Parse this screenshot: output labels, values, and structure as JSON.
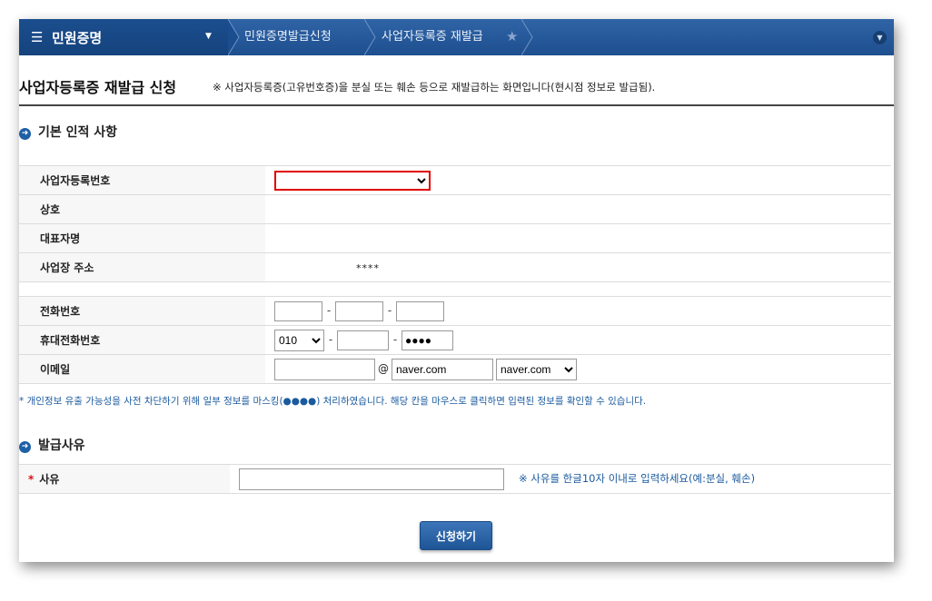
{
  "header": {
    "menu_icon": "☰",
    "menu_title": "민원증명",
    "menu_caret": "▼",
    "breadcrumb": [
      "민원증명발급신청",
      "사업자등록증 재발급"
    ],
    "star_icon": "★",
    "expand_icon": "▼"
  },
  "page": {
    "title": "사업자등록증 재발급 신청",
    "description": "※ 사업자등록증(고유번호증)을 분실 또는 훼손 등으로 재발급하는 화면입니다(현시점 정보로 발급됨)."
  },
  "basic_section": {
    "heading": "기본 인적 사항",
    "bullet": "➜",
    "fields": {
      "bizno_label": "사업자등록번호",
      "bizno_value": "",
      "company_label": "상호",
      "company_value": "",
      "ceo_label": "대표자명",
      "ceo_value": "",
      "address_label": "사업장 주소",
      "address_value": "****"
    }
  },
  "contact": {
    "phone_label": "전화번호",
    "phone": [
      "",
      "",
      ""
    ],
    "mobile_label": "휴대전화번호",
    "mobile_prefix": "010",
    "mobile_mid": "",
    "mobile_last": "●●●●",
    "dash": "-",
    "email_label": "이메일",
    "email_id": "",
    "at": "@",
    "email_domain": "naver.com",
    "email_domain_select": "naver.com"
  },
  "notice": "* 개인정보 유출 가능성을 사전 차단하기 위해 일부 정보를 마스킹(●●●●) 처리하였습니다. 해당 칸을 마우스로 클릭하면 입력된 정보를 확인할 수 있습니다.",
  "reason_section": {
    "heading": "발급사유",
    "bullet": "➜",
    "required_mark": "*",
    "label": "사유",
    "value": "",
    "hint": "※ 사유를 한글10자 이내로 입력하세요(예:분실, 훼손)"
  },
  "submit_label": "신청하기",
  "colors": {
    "header_blue": "#2f64a6",
    "menu_blue": "#1b4e8e",
    "highlight_red": "#e00000",
    "notice_blue": "#1a5a9e"
  }
}
